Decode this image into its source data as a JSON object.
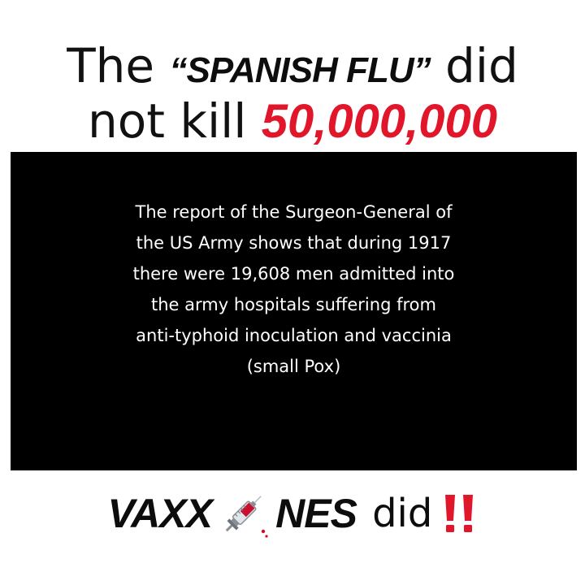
{
  "headline": {
    "line1_prefix": "The",
    "line1_emphasis": "“SPANISH FLU”",
    "line1_suffix": "did",
    "line2_prefix": "not kill",
    "line2_number": "50,000,000",
    "text_color": "#111111",
    "number_color": "#e2162a"
  },
  "quote": {
    "lines": [
      "The report of the Surgeon-General of",
      "the US Army shows that during 1917",
      "there were 19,608 men admitted into",
      "the army hospitals suffering from",
      "anti-typhoid inoculation and vaccinia",
      "(small Pox)"
    ],
    "background": "#000000",
    "text_color": "#ffffff"
  },
  "footer": {
    "word_part1": "VAXX",
    "syringe_icon": "syringe-icon",
    "word_part2": "NES",
    "suffix": "did",
    "alarm_icon": "double-exclamation-icon",
    "alarm_color": "#e2162a"
  }
}
